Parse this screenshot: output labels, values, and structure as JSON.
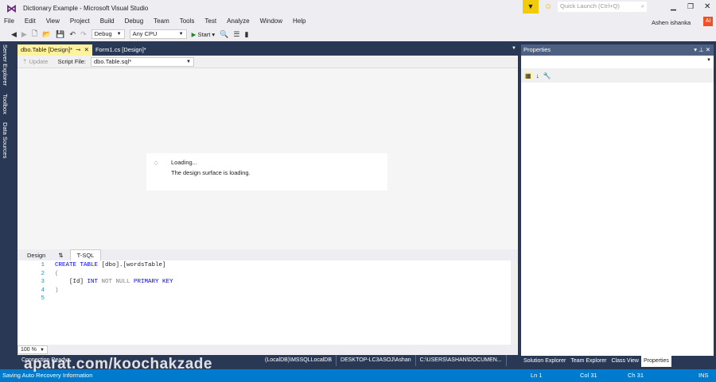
{
  "window": {
    "title": "Dictionary Example - Microsoft Visual Studio",
    "quick_launch_placeholder": "Quick Launch (Ctrl+Q)",
    "user": "Ashen ishanka",
    "user_initials": "AI"
  },
  "menu": [
    "File",
    "Edit",
    "View",
    "Project",
    "Build",
    "Debug",
    "Team",
    "Tools",
    "Test",
    "Analyze",
    "Window",
    "Help"
  ],
  "toolbar": {
    "config": "Debug",
    "platform": "Any CPU",
    "start_label": "Start"
  },
  "side_tabs": [
    "Server Explorer",
    "Toolbox",
    "Data Sources"
  ],
  "doc_tabs": [
    {
      "label": "dbo.Table [Design]*",
      "active": true
    },
    {
      "label": "Form1.cs [Design]*",
      "active": false
    }
  ],
  "editor_toolbar": {
    "update_label": "Update",
    "script_file_label": "Script File:",
    "script_file_value": "dbo.Table.sql*"
  },
  "loading": {
    "title": "Loading...",
    "message": "The design surface is loading."
  },
  "pane_tabs": [
    "Design",
    "⇅",
    "T-SQL"
  ],
  "code": {
    "line_numbers": [
      "1",
      "2",
      "3",
      "4",
      "5"
    ],
    "lines": [
      [
        {
          "t": "CREATE TABLE ",
          "c": "kw"
        },
        {
          "t": "[dbo].[wordsTable]",
          "c": ""
        }
      ],
      [
        {
          "t": "(",
          "c": "gr"
        }
      ],
      [
        {
          "t": "    [Id] ",
          "c": ""
        },
        {
          "t": "INT ",
          "c": "kw"
        },
        {
          "t": "NOT NULL ",
          "c": "gr"
        },
        {
          "t": "PRIMARY KEY",
          "c": "pk"
        }
      ],
      [
        {
          "t": ")",
          "c": "gr"
        }
      ],
      []
    ]
  },
  "zoom_level": "100 %",
  "connection": {
    "status": "Connection Ready",
    "server": "(LocalDB)\\MSSQLLocalDB",
    "user": "DESKTOP-LC3ASOJ\\Ashan",
    "path": "C:\\USERS\\ASHAN\\DOCUMEN..."
  },
  "properties": {
    "title": "Properties"
  },
  "right_tabs": [
    {
      "label": "Solution Explorer",
      "active": false
    },
    {
      "label": "Team Explorer",
      "active": false
    },
    {
      "label": "Class View",
      "active": false
    },
    {
      "label": "Properties",
      "active": true
    }
  ],
  "status": {
    "message": "Saving Auto Recovery Information",
    "ln": "Ln 1",
    "col": "Col 31",
    "ch": "Ch 31",
    "mode": "INS"
  },
  "watermark": "aparat.com/koochakzade",
  "colors": {
    "accent": "#007acc",
    "frame": "#293955",
    "active_tab": "#fff29d"
  }
}
